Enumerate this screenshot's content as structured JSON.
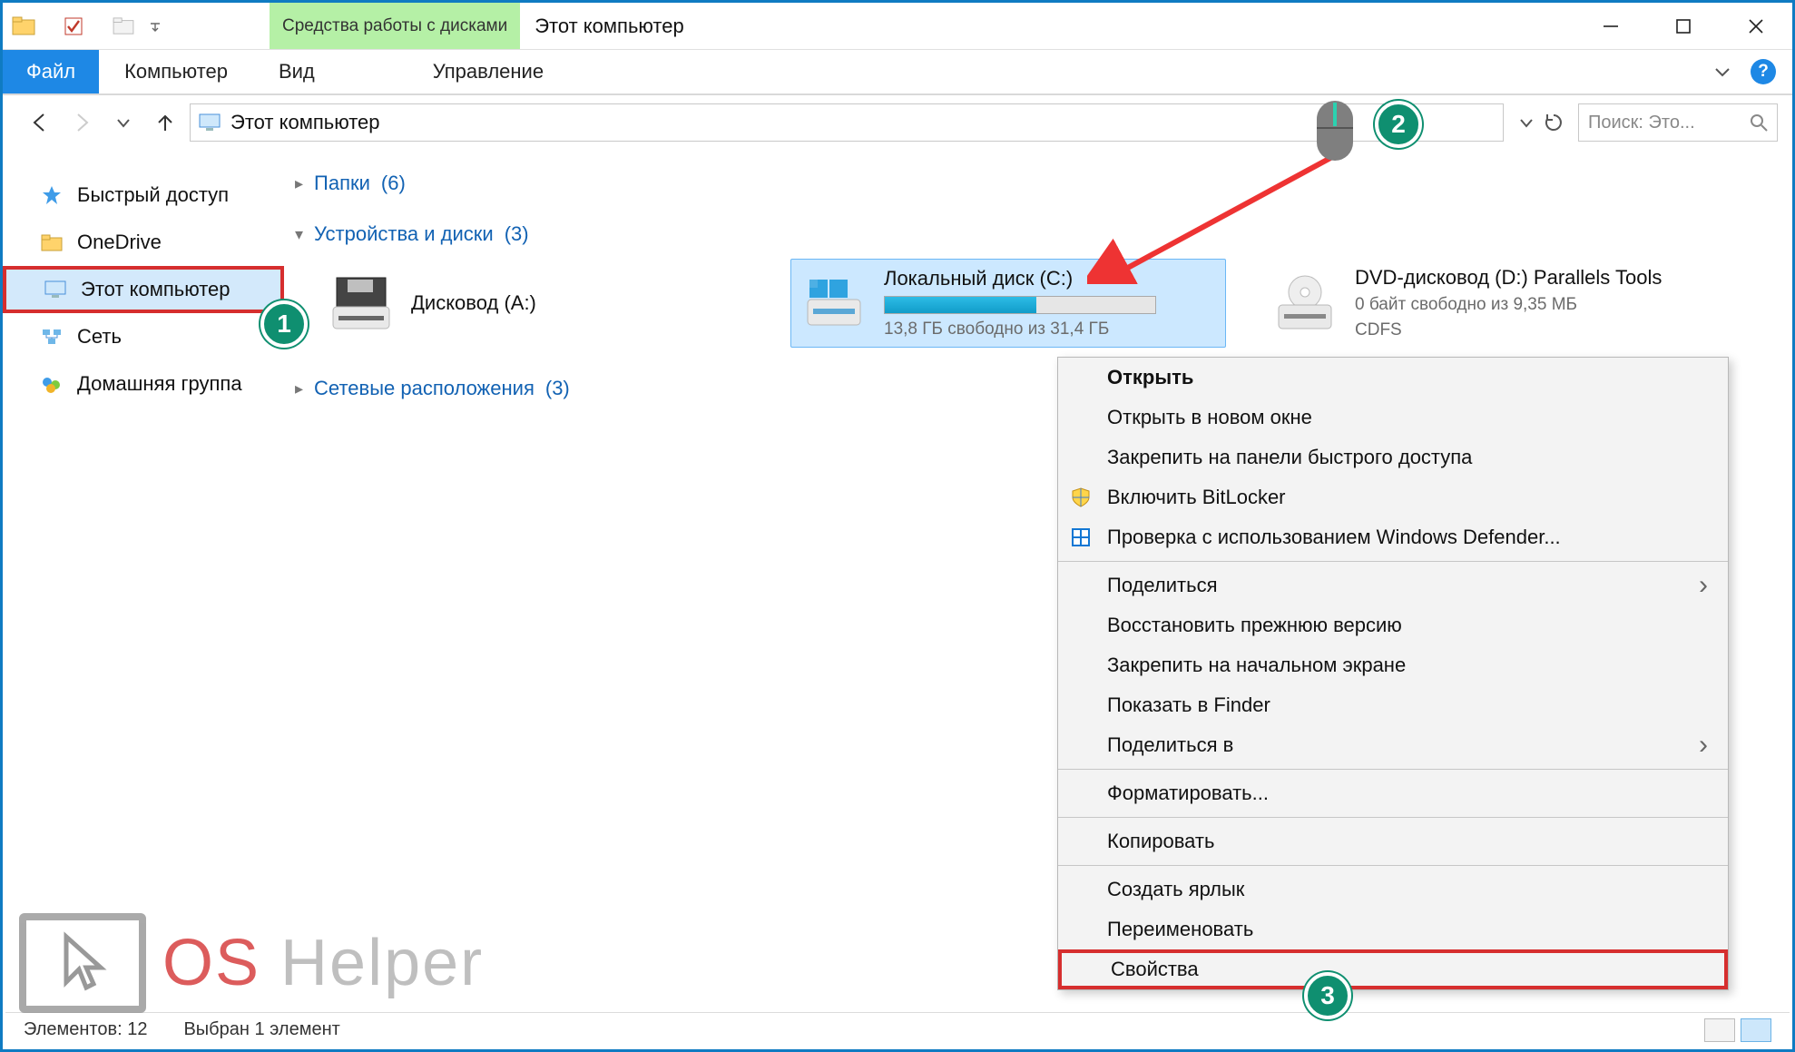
{
  "titlebar": {
    "contextual_tab_label": "Средства работы с дисками",
    "window_title": "Этот компьютер"
  },
  "ribbon": {
    "file": "Файл",
    "computer": "Компьютер",
    "view": "Вид",
    "manage": "Управление"
  },
  "nav": {
    "address_text": "Этот компьютер",
    "search_placeholder": "Поиск: Это..."
  },
  "sidebar": {
    "items": [
      {
        "label": "Быстрый доступ"
      },
      {
        "label": "OneDrive"
      },
      {
        "label": "Этот компьютер"
      },
      {
        "label": "Сеть"
      },
      {
        "label": "Домашняя группа"
      }
    ]
  },
  "groups": {
    "folders": {
      "label": "Папки",
      "count_suffix": "(6)"
    },
    "devices": {
      "label": "Устройства и диски",
      "count_suffix": "(3)"
    },
    "network": {
      "label": "Сетевые расположения",
      "count_suffix": "(3)"
    }
  },
  "drives": {
    "floppy": {
      "name": "Дисковод (A:)"
    },
    "local_c": {
      "name": "Локальный диск (C:)",
      "sub": "13,8 ГБ свободно из 31,4 ГБ",
      "fill_pct": 56
    },
    "dvd": {
      "name": "DVD-дисковод (D:) Parallels Tools",
      "sub": "0 байт свободно из 9,35 МБ",
      "fs": "CDFS"
    }
  },
  "context_menu": [
    {
      "label": "Открыть",
      "bold": true
    },
    {
      "label": "Открыть в новом окне"
    },
    {
      "label": "Закрепить на панели быстрого доступа"
    },
    {
      "label": "Включить BitLocker",
      "icon": "shield"
    },
    {
      "label": "Проверка с использованием Windows Defender...",
      "icon": "defender"
    },
    {
      "sep": true
    },
    {
      "label": "Поделиться",
      "submenu": true
    },
    {
      "label": "Восстановить прежнюю версию"
    },
    {
      "label": "Закрепить на начальном экране"
    },
    {
      "label": "Показать в Finder"
    },
    {
      "label": "Поделиться в",
      "submenu": true
    },
    {
      "sep": true
    },
    {
      "label": "Форматировать..."
    },
    {
      "sep": true
    },
    {
      "label": "Копировать"
    },
    {
      "sep": true
    },
    {
      "label": "Создать ярлык"
    },
    {
      "label": "Переименовать"
    },
    {
      "label": "Свойства",
      "highlight": true
    }
  ],
  "statusbar": {
    "items_label": "Элементов: 12",
    "selection_label": "Выбран 1 элемент"
  },
  "annotations": {
    "badge1": "1",
    "badge2": "2",
    "badge3": "3"
  },
  "watermark": {
    "os": "OS",
    "helper": " Helper"
  }
}
